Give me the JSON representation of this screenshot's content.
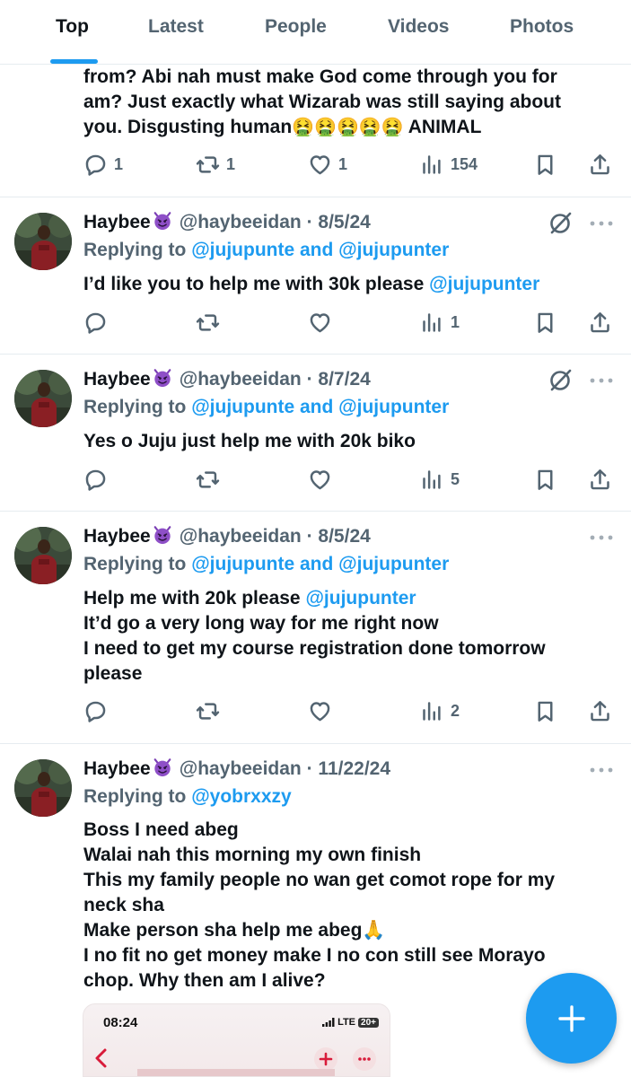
{
  "tabs": [
    {
      "label": "Top",
      "active": true
    },
    {
      "label": "Latest",
      "active": false
    },
    {
      "label": "People",
      "active": false
    },
    {
      "label": "Videos",
      "active": false
    },
    {
      "label": "Photos",
      "active": false
    }
  ],
  "first_post": {
    "lines": [
      "from? Abi nah must make God come through you for",
      "am? Just exactly what Wizarab was still saying about",
      "you. Disgusting human"
    ],
    "emoji_run": "🤮🤮🤮🤮🤮",
    "tail": "ANIMAL",
    "replies": "1",
    "reposts": "1",
    "likes": "1",
    "views": "154"
  },
  "posts": [
    {
      "author": "Haybee",
      "handle": "@haybeeidan",
      "date": "· 8/5/24",
      "reply_prefix": "Replying to",
      "reply_to": "@jujupunte and @jujupunter",
      "text": "I’d like you to help me with 30k please",
      "mention": "@jujupunter",
      "views": "1"
    },
    {
      "author": "Haybee",
      "handle": "@haybeeidan",
      "date": "· 8/7/24",
      "reply_prefix": "Replying to",
      "reply_to": "@jujupunte and @jujupunter",
      "text": "Yes o Juju just help me with 20k biko",
      "views": "5"
    },
    {
      "author": "Haybee",
      "handle": "@haybeeidan",
      "date": "· 8/5/24",
      "reply_prefix": "Replying to",
      "reply_to": "@jujupunte and @jujupunter",
      "line1": "Help me with 20k please",
      "mention": "@jujupunter",
      "line2": "It’d go a very long way for me right now",
      "line3": "I need to get my course registration done tomorrow",
      "line4": "please",
      "views": "2"
    },
    {
      "author": "Haybee",
      "handle": "@haybeeidan",
      "date": "· 11/22/24",
      "reply_prefix": "Replying to",
      "reply_to": "@yobrxxzy",
      "lines": [
        "Boss I need abeg",
        "Walai nah this morning my own finish",
        "This my family people no wan get comot rope for my",
        "neck sha",
        "Make person sha help me abeg🙏",
        "I no fit no get money make I no con still see Morayo",
        "chop. Why then am I alive?"
      ],
      "screenshot": {
        "time": "08:24",
        "network": "LTE",
        "battery": "20+"
      }
    }
  ],
  "colors": {
    "accent": "#1d9bf0",
    "secondary_text": "#536471",
    "primary_text": "#0f1419",
    "divider": "#e6ecf0"
  },
  "icons": [
    "reply-icon",
    "repost-icon",
    "like-icon",
    "views-icon",
    "bookmark-icon",
    "share-icon",
    "more-icon",
    "grok-icon",
    "compose-icon"
  ]
}
